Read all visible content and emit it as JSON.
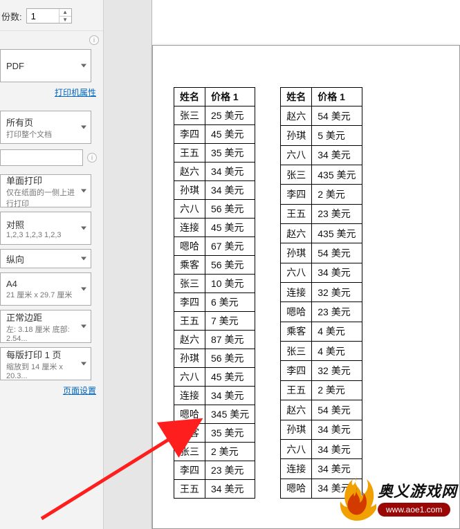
{
  "copies": {
    "label": "份数:",
    "value": "1"
  },
  "printer": {
    "label": "PDF"
  },
  "printer_props_link": "打印机属性",
  "print_range": {
    "line1": "所有页",
    "line2": "打印整个文档"
  },
  "pages_input": {
    "value": ""
  },
  "duplex": {
    "line1": "单面打印",
    "line2": "仅在纸面的一侧上进行打印"
  },
  "collate": {
    "line1": "对照",
    "line2": "1,2,3     1,2,3     1,2,3"
  },
  "orientation": {
    "line1": "纵向"
  },
  "paper": {
    "line1": "A4",
    "line2": "21 厘米 x 29.7 厘米"
  },
  "margins": {
    "line1": "正常边距",
    "line2": "左: 3.18 厘米 底部: 2.54..."
  },
  "scale": {
    "line1": "每版打印 1 页",
    "line2": "缩放到 14 厘米 x 20.3..."
  },
  "page_setup_link": "页面设置",
  "table_headers": {
    "name": "姓名",
    "price": "价格 1"
  },
  "table1": [
    {
      "name": "张三",
      "price": "25 美元"
    },
    {
      "name": "李四",
      "price": "45 美元"
    },
    {
      "name": "王五",
      "price": "35 美元"
    },
    {
      "name": "赵六",
      "price": "34 美元"
    },
    {
      "name": "孙琪",
      "price": "34 美元"
    },
    {
      "name": "六八",
      "price": "56 美元"
    },
    {
      "name": "连接",
      "price": "45 美元"
    },
    {
      "name": "嗯哈",
      "price": "67 美元"
    },
    {
      "name": "乘客",
      "price": "56 美元"
    },
    {
      "name": "张三",
      "price": "10 美元"
    },
    {
      "name": "李四",
      "price": "6 美元"
    },
    {
      "name": "王五",
      "price": "7 美元"
    },
    {
      "name": "赵六",
      "price": "87 美元"
    },
    {
      "name": "孙琪",
      "price": "56 美元"
    },
    {
      "name": "六八",
      "price": "45 美元"
    },
    {
      "name": "连接",
      "price": "34 美元"
    },
    {
      "name": "嗯哈",
      "price": "345 美元"
    },
    {
      "name": "乘客",
      "price": "35 美元"
    },
    {
      "name": "张三",
      "price": "2 美元"
    },
    {
      "name": "李四",
      "price": "23 美元"
    },
    {
      "name": "王五",
      "price": "34 美元"
    }
  ],
  "table2": [
    {
      "name": "赵六",
      "price": "54 美元"
    },
    {
      "name": "孙琪",
      "price": "5 美元"
    },
    {
      "name": "六八",
      "price": "34 美元"
    },
    {
      "name": "张三",
      "price": "435 美元"
    },
    {
      "name": "李四",
      "price": "2 美元"
    },
    {
      "name": "王五",
      "price": "23 美元"
    },
    {
      "name": "赵六",
      "price": "435 美元"
    },
    {
      "name": "孙琪",
      "price": "54 美元"
    },
    {
      "name": "六八",
      "price": "34 美元"
    },
    {
      "name": "连接",
      "price": "32 美元"
    },
    {
      "name": "嗯哈",
      "price": "23 美元"
    },
    {
      "name": "乘客",
      "price": "4 美元"
    },
    {
      "name": "张三",
      "price": "4 美元"
    },
    {
      "name": "李四",
      "price": "32 美元"
    },
    {
      "name": "王五",
      "price": "2 美元"
    },
    {
      "name": "赵六",
      "price": "54 美元"
    },
    {
      "name": "孙琪",
      "price": "34 美元"
    },
    {
      "name": "六八",
      "price": "34 美元"
    },
    {
      "name": "连接",
      "price": "34 美元"
    },
    {
      "name": "嗯哈",
      "price": "34 美元"
    }
  ],
  "watermark": {
    "text": "奥义游戏网",
    "url": "www.aoe1.com"
  }
}
